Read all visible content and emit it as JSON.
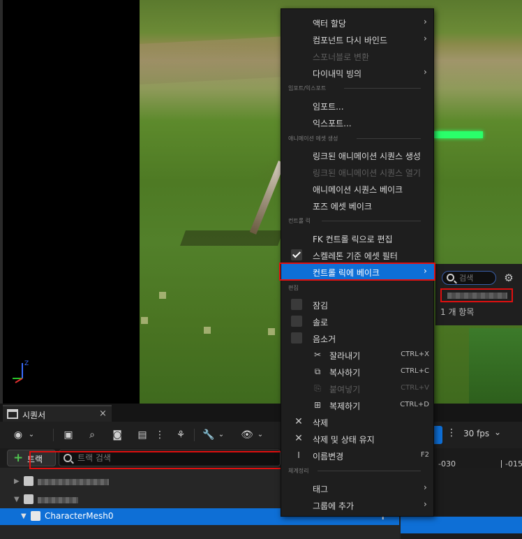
{
  "sequencer": {
    "tab_label": "시퀀서",
    "tab_close": "×",
    "track_button_label": "트랙",
    "track_search_placeholder": "트랙 검색",
    "fps_label": "30 fps",
    "tick_labels": [
      "-030",
      "-015"
    ],
    "selected_row_label": "CharacterMesh0",
    "selected_row_add": "+"
  },
  "details": {
    "search_placeholder": "검색",
    "item_count": "1 개 항목"
  },
  "context_menu": {
    "items": [
      {
        "label": "액터 할당",
        "submenu": true,
        "disabled": false
      },
      {
        "label": "컴포넌트 다시 바인드",
        "submenu": true,
        "disabled": false
      },
      {
        "label": "스포너블로 변환",
        "submenu": false,
        "disabled": true
      },
      {
        "label": "다이내믹 빙의",
        "submenu": true,
        "disabled": false
      }
    ],
    "section_import_export": "임포트/익스포트",
    "import_label": "임포트...",
    "export_label": "익스포트...",
    "section_anim_asset": "애니메이션 에셋 생성",
    "anim_items": [
      {
        "label": "링크된 애니메이션 시퀀스 생성",
        "disabled": false
      },
      {
        "label": "링크된 애니메이션 시퀀스 열기",
        "disabled": true
      },
      {
        "label": "애니메이션 시퀀스 베이크",
        "disabled": false
      },
      {
        "label": "포즈 에셋 베이크",
        "disabled": false
      }
    ],
    "section_control_rig": "컨트롤 릭",
    "fk_edit_label": "FK 컨트롤 릭으로 편집",
    "skeleton_filter_label": "스켈레톤 기준 에셋 필터",
    "skeleton_filter_checked": true,
    "bake_control_rig_label": "컨트롤 릭에 베이크",
    "section_edit": "편집",
    "lock_label": "잠김",
    "solo_label": "솔로",
    "mute_label": "음소거",
    "cut_label": "잘라내기",
    "cut_shortcut": "CTRL+X",
    "copy_label": "복사하기",
    "copy_shortcut": "CTRL+C",
    "paste_label": "붙여넣기",
    "paste_shortcut": "CTRL+V",
    "duplicate_label": "복제하기",
    "duplicate_shortcut": "CTRL+D",
    "delete_label": "삭제",
    "delete_keep_state_label": "삭제 및 상태 유지",
    "rename_label": "이름변경",
    "rename_shortcut": "F2",
    "section_organize": "체계정리",
    "tags_label": "태그",
    "add_to_group_label": "그룹에 추가",
    "submenu_arrow": "›"
  },
  "colors": {
    "highlight": "#0e6fd6",
    "annotation_frame": "#e01010"
  }
}
